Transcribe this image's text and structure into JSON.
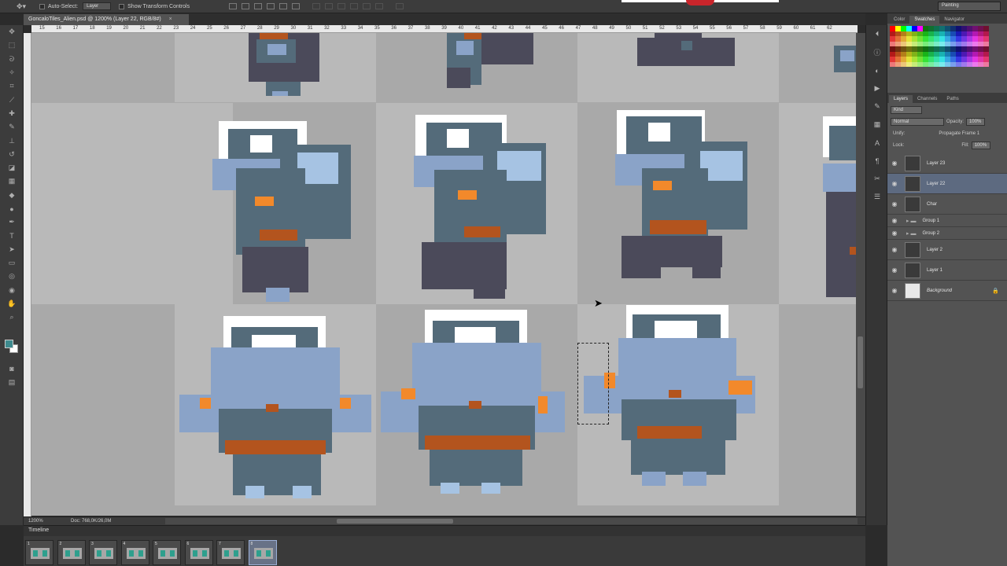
{
  "options_bar": {
    "auto_select_label": "Auto-Select:",
    "auto_select_value": "Layer",
    "show_transform_label": "Show Transform Controls",
    "workspace": "Painting"
  },
  "document": {
    "tab_title": "GoncaloTiles_Alien.psd @ 1200% (Layer 22, RGB/8#)",
    "close_glyph": "×"
  },
  "rulers": {
    "top": [
      "15",
      "16",
      "17",
      "18",
      "19",
      "20",
      "21",
      "22",
      "23",
      "24",
      "25",
      "26",
      "27",
      "28",
      "29",
      "30",
      "31",
      "32",
      "33",
      "34",
      "35",
      "36",
      "37",
      "38",
      "39",
      "40",
      "41",
      "42",
      "43",
      "44",
      "45",
      "46",
      "47",
      "48",
      "49",
      "50",
      "51",
      "52",
      "53",
      "54",
      "55",
      "56",
      "57",
      "58",
      "59",
      "60",
      "61",
      "62"
    ]
  },
  "status": {
    "zoom": "1200%",
    "doc_size": "Doc: 768,0K/26,0M"
  },
  "timeline": {
    "title": "Timeline",
    "frames": [
      "1",
      "2",
      "3",
      "4",
      "5",
      "6",
      "7",
      "8"
    ],
    "active_frame": 8
  },
  "swatches_panel": {
    "tabs": [
      "Color",
      "Swatches",
      "Navigator"
    ],
    "active_tab": "Swatches"
  },
  "layers_panel": {
    "tabs": [
      "Layers",
      "Channels",
      "Paths"
    ],
    "active_tab": "Layers",
    "filter_kind": "Kind",
    "blend_mode": "Normal",
    "opacity_label": "Opacity:",
    "opacity_value": "100%",
    "unify_label": "Unify:",
    "propagate_label": "Propagate Frame 1",
    "lock_label": "Lock:",
    "fill_label": "Fill:",
    "fill_value": "100%",
    "layers": [
      {
        "name": "Layer 23",
        "type": "layer",
        "selected": false
      },
      {
        "name": "Layer 22",
        "type": "layer",
        "selected": true
      },
      {
        "name": "Char",
        "type": "layer",
        "selected": false
      },
      {
        "name": "Group 1",
        "type": "group",
        "selected": false
      },
      {
        "name": "Group 2",
        "type": "group",
        "selected": false
      },
      {
        "name": "Layer 2",
        "type": "layer",
        "selected": false
      },
      {
        "name": "Layer 1",
        "type": "layer",
        "selected": false
      },
      {
        "name": "Background",
        "type": "background",
        "selected": false
      }
    ]
  },
  "palette": {
    "outline": "#4b4a5a",
    "armor_dark": "#546b7a",
    "armor_light": "#8aa3c8",
    "armor_highlight": "#a6c3e3",
    "helmet_glass": "#ffffff",
    "accent_orange": "#f2892b",
    "belt_brown": "#b3541e"
  }
}
